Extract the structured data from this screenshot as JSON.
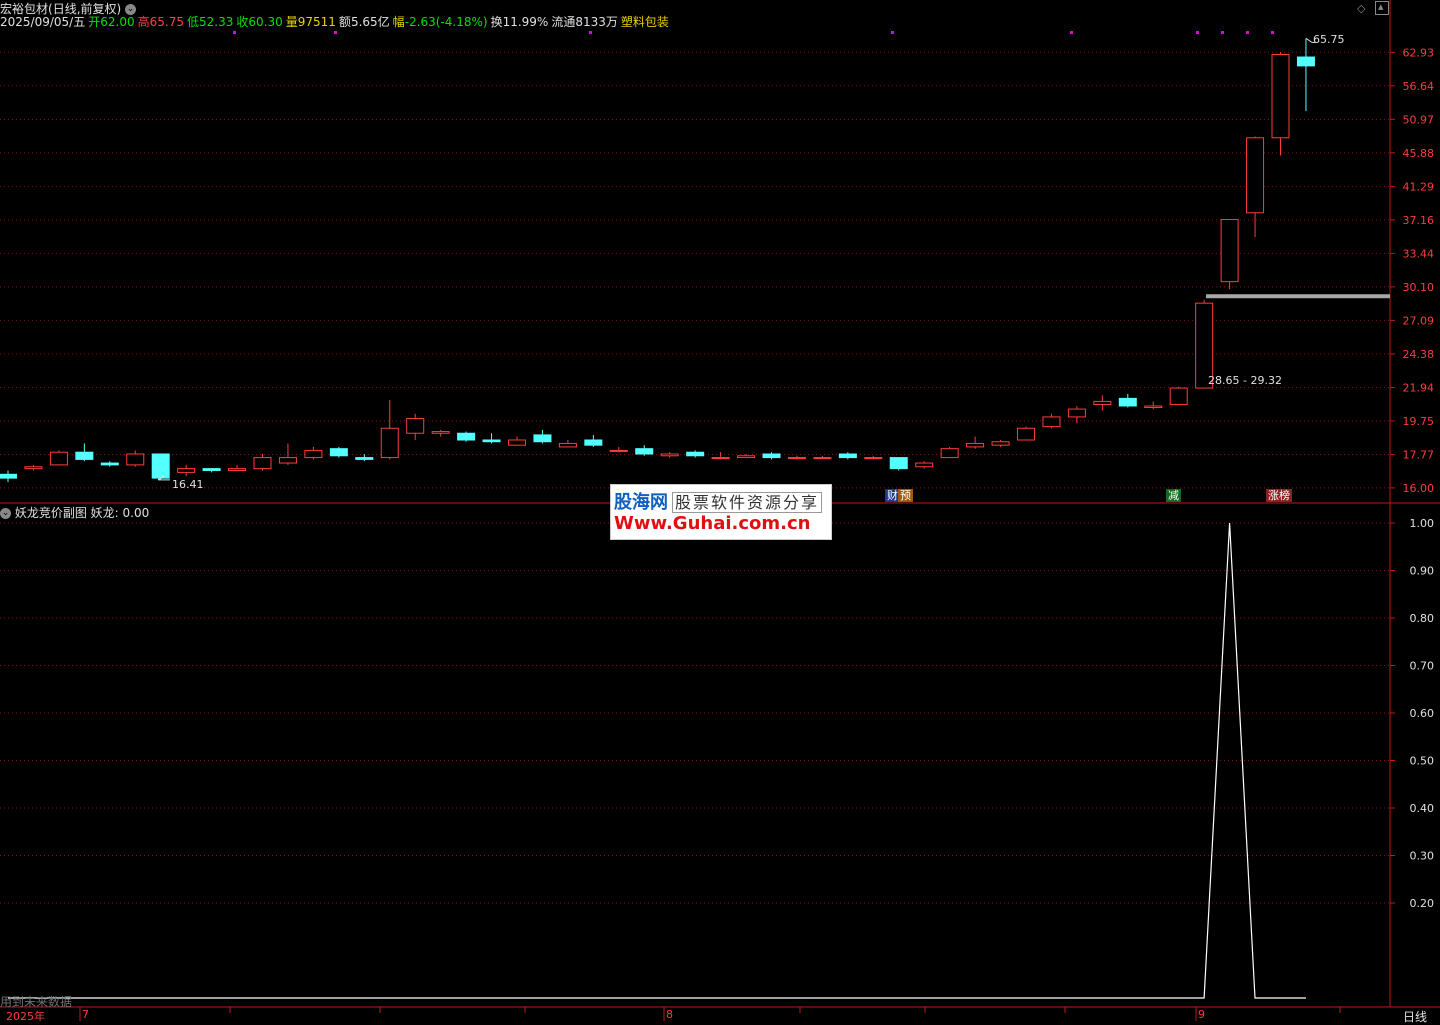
{
  "header": {
    "stock_name": "宏裕包材",
    "mode": "(日线,前复权)",
    "date": "2025/09/05/五",
    "open_label": "开",
    "open": "62.00",
    "high_label": "高",
    "high": "65.75",
    "low_label": "低",
    "low": "52.33",
    "close_label": "收",
    "close": "60.30",
    "volume_label": "量",
    "volume": "97511",
    "amount_label": "额",
    "amount": "5.65亿",
    "change_label": "幅",
    "change": "-2.63(-4.18%)",
    "turnover_label": "换",
    "turnover": "11.99%",
    "float_label": "流通",
    "float_value": "8133万",
    "sector": "塑料包装"
  },
  "annotations": {
    "high_marker": "65.75",
    "low_marker": "16.41",
    "range_label": "28.65 - 29.32",
    "tag_cai": "财",
    "tag_yu": "预",
    "tag_jian": "减",
    "tag_zhangbang": "涨榜"
  },
  "watermark": {
    "brand": "股海网",
    "slogan": "股票软件资源分享",
    "url": "Www.Guhai.com.cn"
  },
  "sub_panel": {
    "title": "妖龙竞价副图",
    "value_label": "妖龙: 0.00",
    "future_note": "用到未来数据"
  },
  "x_axis": {
    "year": "2025年",
    "m7": "7",
    "m8": "8",
    "m9": "9"
  },
  "period": "日线",
  "colors": {
    "up": "#ff3c3c",
    "down": "#54ffff",
    "grid": "#8a1010",
    "indicator": "#ffffff",
    "range_bar": "#a8a8a8"
  },
  "chart_data": [
    {
      "type": "candlestick",
      "title": "宏裕包材",
      "y_scale": "log",
      "ylim": [
        15.5,
        67.5
      ],
      "y_ticks": [
        62.93,
        56.64,
        50.97,
        45.88,
        41.29,
        37.16,
        33.44,
        30.1,
        27.09,
        24.38,
        21.94,
        19.75,
        17.77,
        16.0
      ],
      "ohlc": [
        [
          16.7,
          16.9,
          16.3,
          16.5
        ],
        [
          17.0,
          17.2,
          16.9,
          17.1
        ],
        [
          17.2,
          18.0,
          17.2,
          17.9
        ],
        [
          17.9,
          18.4,
          17.4,
          17.5
        ],
        [
          17.3,
          17.4,
          17.1,
          17.2
        ],
        [
          17.2,
          18.0,
          17.1,
          17.8
        ],
        [
          17.8,
          17.8,
          16.4,
          16.5
        ],
        [
          16.8,
          17.2,
          16.6,
          17.0
        ],
        [
          17.0,
          17.0,
          16.8,
          16.9
        ],
        [
          16.9,
          17.2,
          16.9,
          17.0
        ],
        [
          17.0,
          17.8,
          16.9,
          17.6
        ],
        [
          17.3,
          18.4,
          17.2,
          17.6
        ],
        [
          17.6,
          18.2,
          17.5,
          18.0
        ],
        [
          18.1,
          18.2,
          17.6,
          17.7
        ],
        [
          17.6,
          17.8,
          17.4,
          17.5
        ],
        [
          17.6,
          21.1,
          17.5,
          19.3
        ],
        [
          19.0,
          20.2,
          18.6,
          19.9
        ],
        [
          19.0,
          19.2,
          18.8,
          19.1
        ],
        [
          19.0,
          19.1,
          18.5,
          18.6
        ],
        [
          18.6,
          19.0,
          18.4,
          18.5
        ],
        [
          18.3,
          18.8,
          18.3,
          18.6
        ],
        [
          18.9,
          19.2,
          18.4,
          18.5
        ],
        [
          18.2,
          18.6,
          18.2,
          18.4
        ],
        [
          18.6,
          18.9,
          18.2,
          18.3
        ],
        [
          18.0,
          18.2,
          17.9,
          18.0
        ],
        [
          18.1,
          18.3,
          17.7,
          17.8
        ],
        [
          17.7,
          17.9,
          17.6,
          17.8
        ],
        [
          17.9,
          18.0,
          17.6,
          17.7
        ],
        [
          17.6,
          17.9,
          17.5,
          17.6
        ],
        [
          17.6,
          17.8,
          17.6,
          17.7
        ],
        [
          17.8,
          17.9,
          17.5,
          17.6
        ],
        [
          17.6,
          17.7,
          17.5,
          17.6
        ],
        [
          17.6,
          17.7,
          17.6,
          17.6
        ],
        [
          17.8,
          17.9,
          17.5,
          17.6
        ],
        [
          17.6,
          17.7,
          17.5,
          17.6
        ],
        [
          17.6,
          17.6,
          16.9,
          17.0
        ],
        [
          17.1,
          17.4,
          17.0,
          17.3
        ],
        [
          17.6,
          18.2,
          17.6,
          18.1
        ],
        [
          18.2,
          18.8,
          18.1,
          18.4
        ],
        [
          18.3,
          18.6,
          18.2,
          18.5
        ],
        [
          18.6,
          19.4,
          18.6,
          19.3
        ],
        [
          19.4,
          20.2,
          19.3,
          20.0
        ],
        [
          20.0,
          20.7,
          19.6,
          20.5
        ],
        [
          20.8,
          21.4,
          20.4,
          21.0
        ],
        [
          21.2,
          21.5,
          20.6,
          20.7
        ],
        [
          20.6,
          21.0,
          20.5,
          20.7
        ],
        [
          20.8,
          22.0,
          20.8,
          21.9
        ],
        [
          21.9,
          28.9,
          21.9,
          28.6
        ],
        [
          30.6,
          37.2,
          29.9,
          37.2
        ],
        [
          38.0,
          48.3,
          35.2,
          48.1
        ],
        [
          48.1,
          62.93,
          45.5,
          62.5
        ],
        [
          62.0,
          65.75,
          52.33,
          60.3
        ]
      ]
    },
    {
      "type": "line",
      "title": "妖龙竞价副图",
      "series": [
        {
          "name": "妖龙",
          "values": [
            0,
            0,
            0,
            0,
            0,
            0,
            0,
            0,
            0,
            0,
            0,
            0,
            0,
            0,
            0,
            0,
            0,
            0,
            0,
            0,
            0,
            0,
            0,
            0,
            0,
            0,
            0,
            0,
            0,
            0,
            0,
            0,
            0,
            0,
            0,
            0,
            0,
            0,
            0,
            0,
            0,
            0,
            0,
            0,
            0,
            0,
            0,
            0,
            1.0,
            0,
            0,
            0
          ]
        }
      ],
      "ylim": [
        0,
        1.0
      ],
      "y_ticks": [
        "1.00",
        "0.90",
        "0.80",
        "0.70",
        "0.60",
        "0.50",
        "0.40",
        "0.30",
        "0.20"
      ]
    }
  ]
}
